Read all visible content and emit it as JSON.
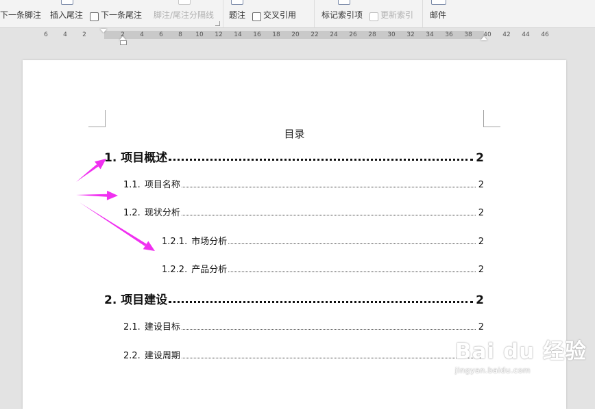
{
  "ribbon": {
    "next_footnote": "下一条脚注",
    "insert_endnote": "插入尾注",
    "next_endnote": "下一条尾注",
    "separator_line": "脚注/尾注分隔线",
    "caption": "题注",
    "cross_reference": "交叉引用",
    "mark_index_entry": "标记索引项",
    "update_index": "更新索引",
    "mailings": "邮件"
  },
  "ruler": {
    "ticks": [
      "6",
      "4",
      "2",
      "2",
      "4",
      "6",
      "8",
      "10",
      "12",
      "14",
      "16",
      "18",
      "20",
      "22",
      "24",
      "26",
      "28",
      "30",
      "32",
      "34",
      "36",
      "38",
      "40",
      "42",
      "44",
      "46"
    ]
  },
  "document": {
    "toc_title": "目录",
    "entries": [
      {
        "num": "1.",
        "text": "项目概述",
        "page": "2"
      },
      {
        "num": "1.1.",
        "text": "项目名称",
        "page": "2"
      },
      {
        "num": "1.2.",
        "text": "现状分析",
        "page": "2"
      },
      {
        "num": "1.2.1.",
        "text": "市场分析",
        "page": "2"
      },
      {
        "num": "1.2.2.",
        "text": "产品分析",
        "page": "2"
      },
      {
        "num": "2.",
        "text": "项目建设",
        "page": "2"
      },
      {
        "num": "2.1.",
        "text": "建设目标",
        "page": "2"
      },
      {
        "num": "2.2.",
        "text": "建设周期",
        "page": "2"
      }
    ]
  },
  "annotation": {
    "arrow_color": "#f030f0"
  },
  "watermark": {
    "logo": "Bai du 经验",
    "url": "jingyan.baidu.com"
  }
}
